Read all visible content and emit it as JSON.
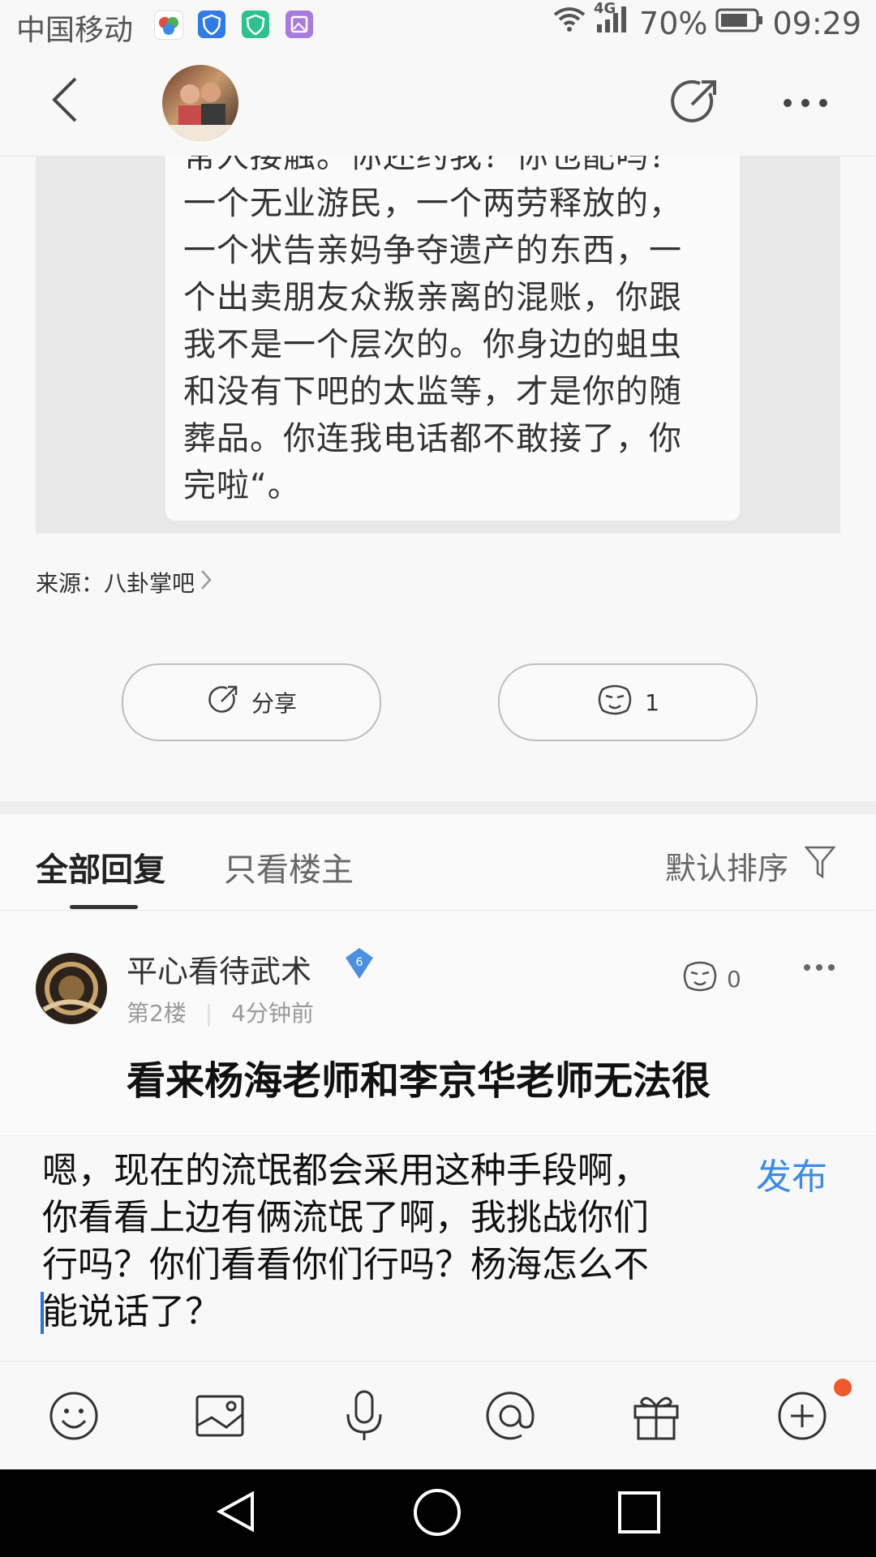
{
  "status_bar": {
    "carrier": "中国移动",
    "network": "4G",
    "battery": "70%",
    "time": "09:29"
  },
  "header": {
    "back_icon": "chevron-left-icon",
    "share_icon": "share-icon",
    "more_icon": "more-dots-icon"
  },
  "article": {
    "quote_lines": [
      "常人接触。你还约我？你也配吗？",
      "一个无业游民，一个两劳释放的，",
      "一个状告亲妈争夺遗产的东西，一",
      "个出卖朋友众叛亲离的混账，你跟",
      "我不是一个层次的。你身边的蛆虫",
      "和没有下吧的太监等，才是你的随",
      "葬品。你连我电话都不敢接了，你",
      "完啦“。"
    ],
    "source_label": "来源：八卦掌吧",
    "share_label": "分享",
    "like_count": "1"
  },
  "tabs": {
    "all": "全部回复",
    "owner_only": "只看楼主",
    "sort": "默认排序"
  },
  "post": {
    "username": "平心看待武术",
    "level": "6",
    "floor": "第2楼",
    "time": "4分钟前",
    "like_count": "0",
    "title": "看来杨海老师和李京华老师无法很"
  },
  "composer": {
    "text": "嗯，现在的流氓都会采用这种手段啊，你看看上边有俩流氓了啊，我挑战你们行吗？你们看看你们行吗？杨海怎么不能说话了？",
    "publish_label": "发布"
  },
  "colors": {
    "accent": "#3b8ce6",
    "notification": "#ef5a2c",
    "badge": "#4a90e2"
  }
}
